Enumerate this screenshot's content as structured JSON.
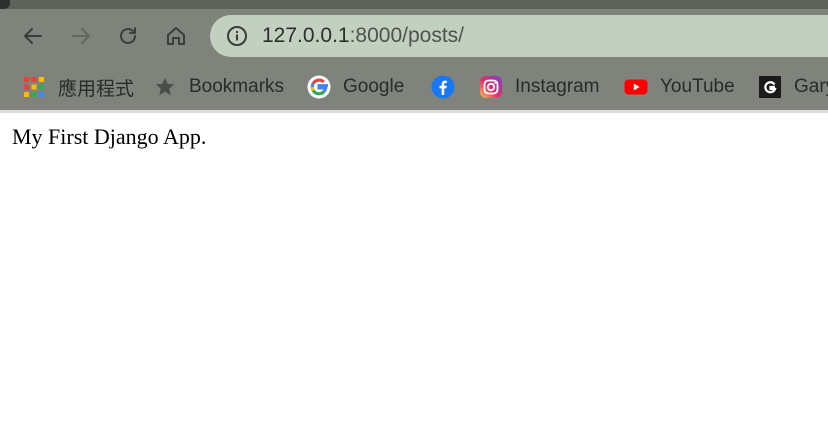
{
  "browser": {
    "url_host": "127.0.0.1",
    "url_path": ":8000/posts/",
    "nav": {
      "back_icon": "arrow-left-icon",
      "forward_icon": "arrow-right-icon",
      "reload_icon": "reload-icon",
      "home_icon": "home-icon",
      "site_info_icon": "info-icon"
    },
    "bookmarks": [
      {
        "label": "應用程式",
        "icon": "apps-grid-icon"
      },
      {
        "label": "Bookmarks",
        "icon": "star-icon"
      },
      {
        "label": "Google",
        "icon": "google-icon"
      },
      {
        "label": "",
        "icon": "facebook-icon"
      },
      {
        "label": "Instagram",
        "icon": "instagram-icon"
      },
      {
        "label": "YouTube",
        "icon": "youtube-icon"
      },
      {
        "label": "Gary",
        "icon": "github-icon"
      }
    ]
  },
  "page": {
    "text": "My First Django App."
  }
}
